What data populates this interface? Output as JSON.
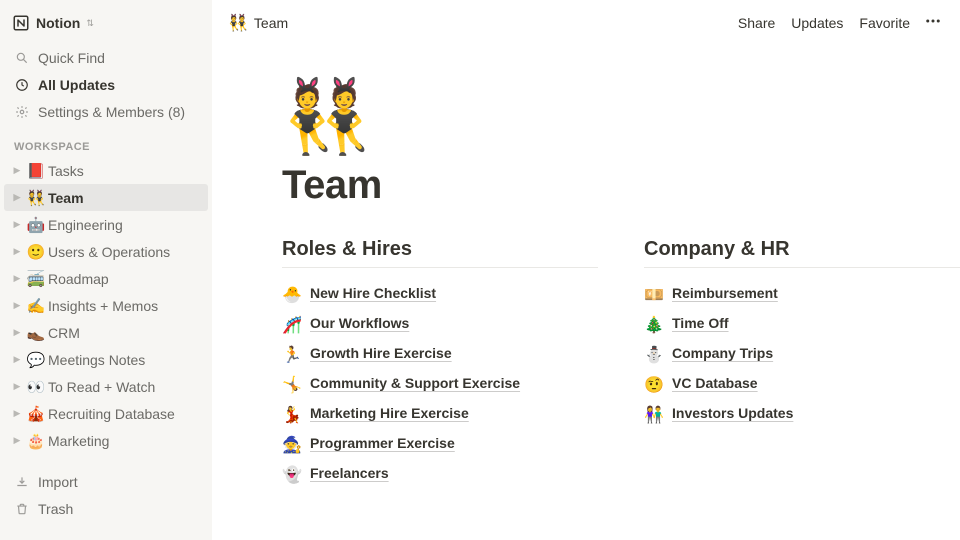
{
  "app": {
    "name": "Notion"
  },
  "sidebar": {
    "quick_find": "Quick Find",
    "all_updates": "All Updates",
    "settings_members": "Settings & Members (8)",
    "section_label": "WORKSPACE",
    "items": [
      {
        "emoji": "📕",
        "label": "Tasks"
      },
      {
        "emoji": "👯",
        "label": "Team"
      },
      {
        "emoji": "🤖",
        "label": "Engineering"
      },
      {
        "emoji": "🙂",
        "label": "Users & Operations"
      },
      {
        "emoji": "🚎",
        "label": "Roadmap"
      },
      {
        "emoji": "✍️",
        "label": "Insights + Memos"
      },
      {
        "emoji": "👞",
        "label": "CRM"
      },
      {
        "emoji": "💬",
        "label": "Meetings Notes"
      },
      {
        "emoji": "👀",
        "label": "To Read + Watch"
      },
      {
        "emoji": "🎪",
        "label": "Recruiting Database"
      },
      {
        "emoji": "🎂",
        "label": "Marketing"
      }
    ],
    "import": "Import",
    "trash": "Trash"
  },
  "topbar": {
    "breadcrumb_emoji": "👯",
    "breadcrumb_label": "Team",
    "share": "Share",
    "updates": "Updates",
    "favorite": "Favorite"
  },
  "page": {
    "icon": "👯",
    "title": "Team",
    "columns": [
      {
        "heading": "Roles & Hires",
        "links": [
          {
            "emoji": "🐣",
            "label": "New Hire Checklist"
          },
          {
            "emoji": "🎢",
            "label": "Our Workflows"
          },
          {
            "emoji": "🏃",
            "label": "Growth Hire Exercise"
          },
          {
            "emoji": "🤸",
            "label": "Community & Support Exercise"
          },
          {
            "emoji": "💃",
            "label": "Marketing Hire Exercise"
          },
          {
            "emoji": "🧙",
            "label": "Programmer Exercise"
          },
          {
            "emoji": "👻",
            "label": "Freelancers"
          }
        ]
      },
      {
        "heading": "Company & HR",
        "links": [
          {
            "emoji": "💴",
            "label": "Reimbursement"
          },
          {
            "emoji": "🎄",
            "label": "Time Off"
          },
          {
            "emoji": "⛄",
            "label": "Company Trips"
          },
          {
            "emoji": "🤨",
            "label": "VC Database"
          },
          {
            "emoji": "👫",
            "label": "Investors Updates"
          }
        ]
      }
    ]
  }
}
